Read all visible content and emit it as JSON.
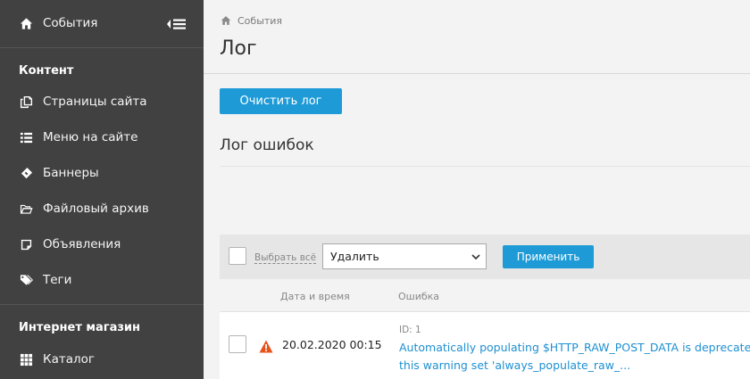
{
  "sidebar": {
    "current": {
      "label": "События",
      "icon": "home-icon"
    },
    "groups": [
      {
        "heading": "Контент",
        "items": [
          {
            "label": "Страницы сайта",
            "icon": "pages-icon"
          },
          {
            "label": "Меню на сайте",
            "icon": "list-icon"
          },
          {
            "label": "Баннеры",
            "icon": "banner-icon"
          },
          {
            "label": "Файловый архив",
            "icon": "folder-icon"
          },
          {
            "label": "Объявления",
            "icon": "note-icon"
          },
          {
            "label": "Теги",
            "icon": "tags-icon"
          }
        ]
      },
      {
        "heading": "Интернет магазин",
        "items": [
          {
            "label": "Каталог",
            "icon": "grid-icon"
          }
        ]
      }
    ]
  },
  "breadcrumb": {
    "label": "События"
  },
  "page": {
    "title": "Лог"
  },
  "actions": {
    "clear_label": "Очистить лог"
  },
  "section": {
    "title": "Лог ошибок"
  },
  "toolbar": {
    "select_all_label": "Выбрать всё",
    "action_value": "Удалить",
    "apply_label": "Применить"
  },
  "table": {
    "columns": [
      "Дата и время",
      "Ошибка"
    ],
    "rows": [
      {
        "id_label": "ID: 1",
        "datetime": "20.02.2020 00:15",
        "message_line1": "Automatically populating $HTTP_RAW_POST_DATA is deprecated a",
        "message_line2": "this warning set 'always_populate_raw_...",
        "status_icon": "warning-icon",
        "status_color": "#e8531c"
      }
    ]
  },
  "colors": {
    "accent": "#1e9bd7",
    "sidebar_bg": "#414141",
    "link": "#1e90d2"
  }
}
